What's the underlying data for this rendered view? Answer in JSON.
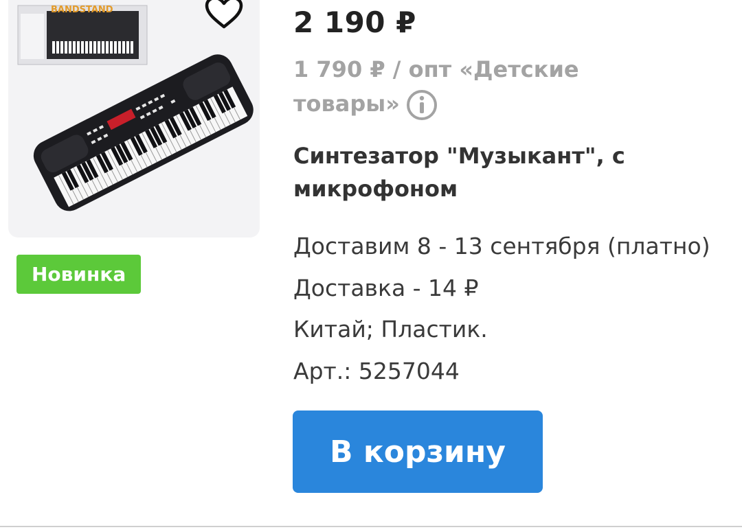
{
  "product": {
    "image_alt": "electronic keyboard",
    "box_label": "BANDSTAND",
    "favorite_icon": "heart-outline-icon",
    "badge": "Новинка",
    "price": "2 190 ₽",
    "wholesale_price": "1 790 ₽ / опт «Детские товары»",
    "info_icon": "info-icon",
    "title": "Синтезатор \"Музыкант\", с микрофоном",
    "delivery_dates": "Доставим 8 - 13 сентября (платно)",
    "delivery_cost": "Доставка - 14 ₽",
    "origin_material": "Китай; Пластик.",
    "article": "Арт.: 5257044",
    "cart_button": "В корзину"
  },
  "colors": {
    "badge_green": "#5cc93a",
    "button_blue": "#2a86dc",
    "muted_gray": "#a3a3a3"
  }
}
